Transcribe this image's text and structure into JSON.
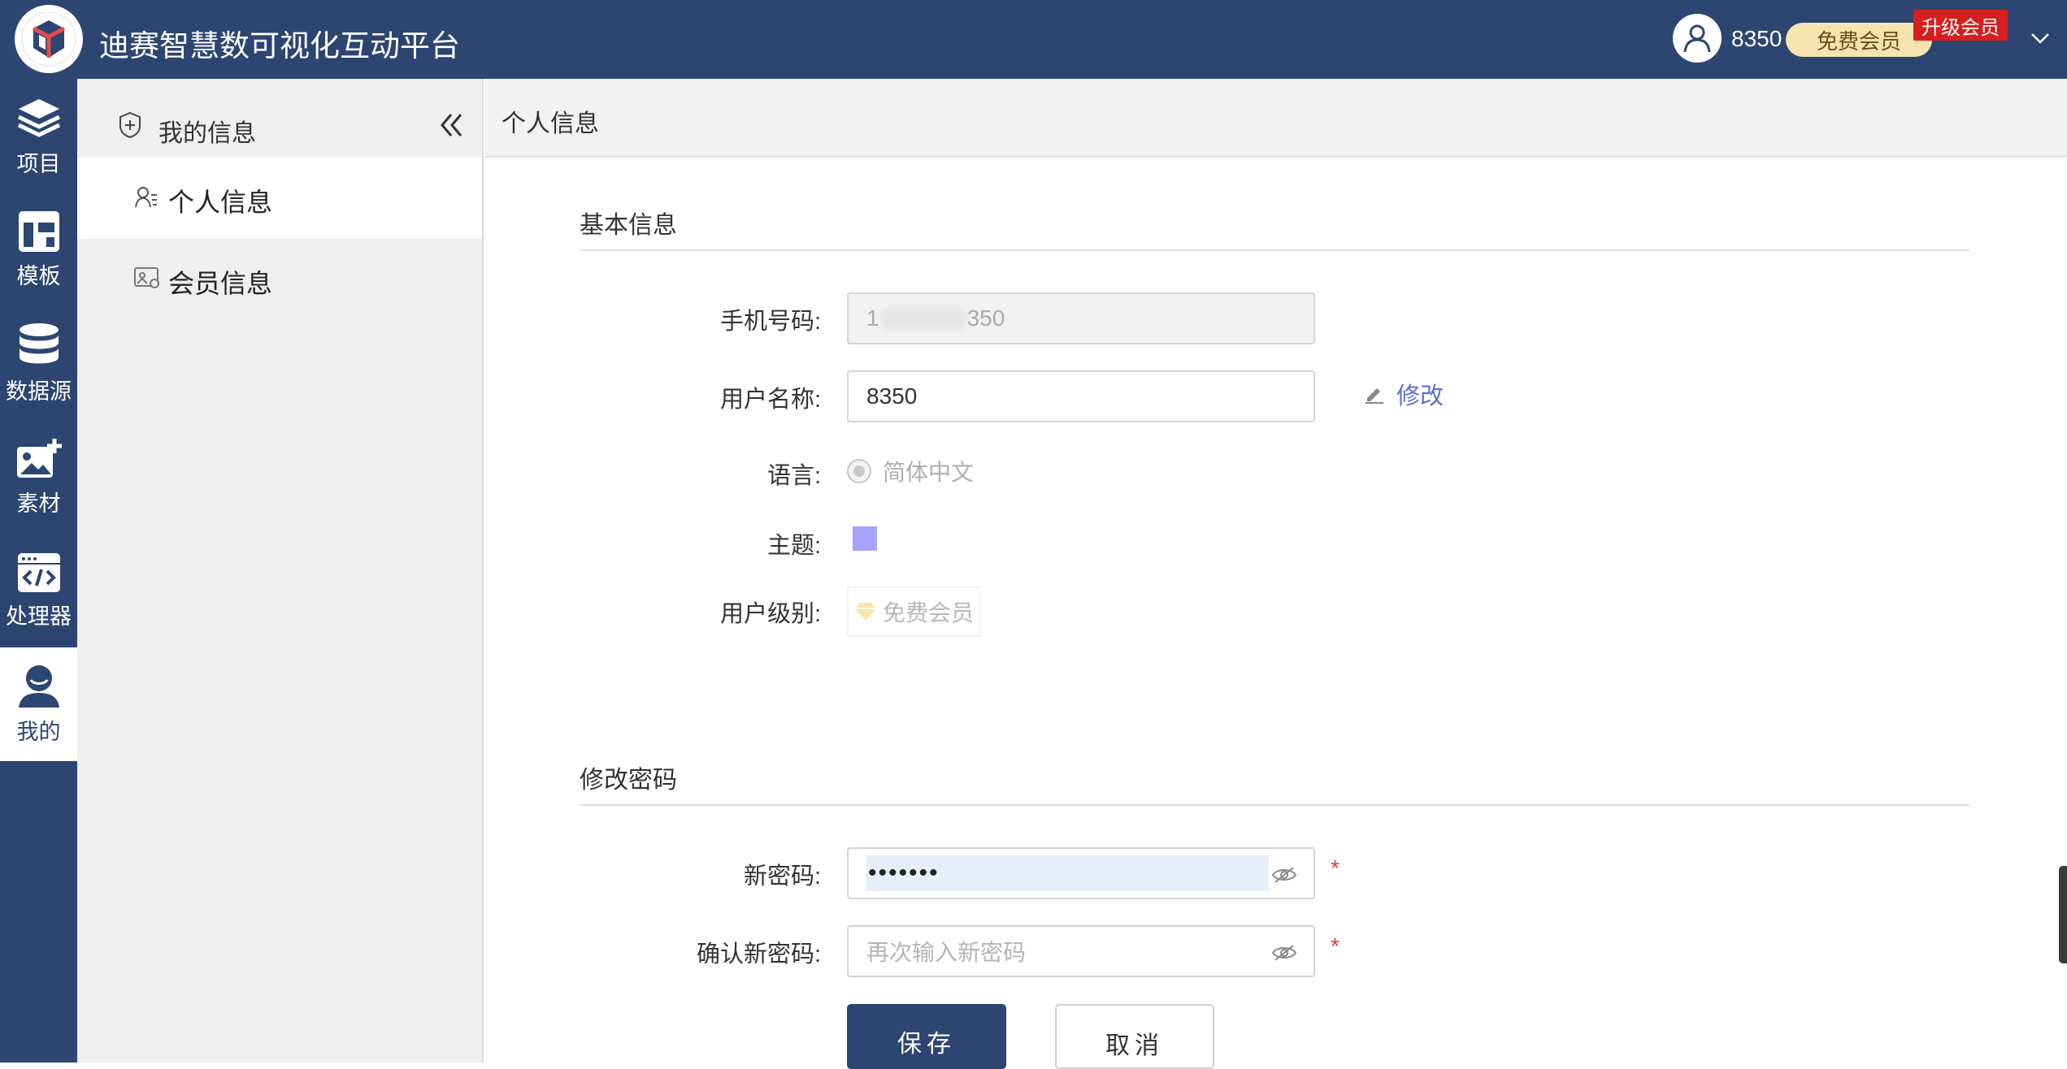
{
  "header": {
    "app_title": "迪赛智慧数可视化互动平台",
    "username": "8350",
    "member_label": "免费会员",
    "upgrade_label": "升级会员"
  },
  "rail": {
    "items": [
      {
        "label": "项目",
        "icon": "layers-icon"
      },
      {
        "label": "模板",
        "icon": "template-icon"
      },
      {
        "label": "数据源",
        "icon": "database-icon"
      },
      {
        "label": "素材",
        "icon": "image-add-icon"
      },
      {
        "label": "处理器",
        "icon": "code-window-icon"
      },
      {
        "label": "我的",
        "icon": "user-icon",
        "active": true
      }
    ]
  },
  "subnav": {
    "title": "我的信息",
    "items": [
      {
        "label": "个人信息",
        "active": true
      },
      {
        "label": "会员信息"
      }
    ]
  },
  "main": {
    "page_title": "个人信息",
    "basic": {
      "section_title": "基本信息",
      "phone_label": "手机号码:",
      "phone_value": "1",
      "phone_tail": "350",
      "username_label": "用户名称:",
      "username_value": "8350",
      "edit_label": "修改",
      "language_label": "语言:",
      "language_value": "简体中文",
      "theme_label": "主题:",
      "theme_color": "#a5a3fb",
      "level_label": "用户级别:",
      "level_value": "免费会员"
    },
    "password": {
      "section_title": "修改密码",
      "new_label": "新密码:",
      "new_value": "•••••••",
      "confirm_label": "确认新密码:",
      "confirm_placeholder": "再次输入新密码",
      "required_mark": "*"
    },
    "actions": {
      "save_label": "保存",
      "cancel_label": "取消"
    }
  },
  "colors": {
    "primary": "#2c4571",
    "link": "#5a6fd6",
    "required": "#e53935",
    "upgrade": "#d61e1e"
  }
}
